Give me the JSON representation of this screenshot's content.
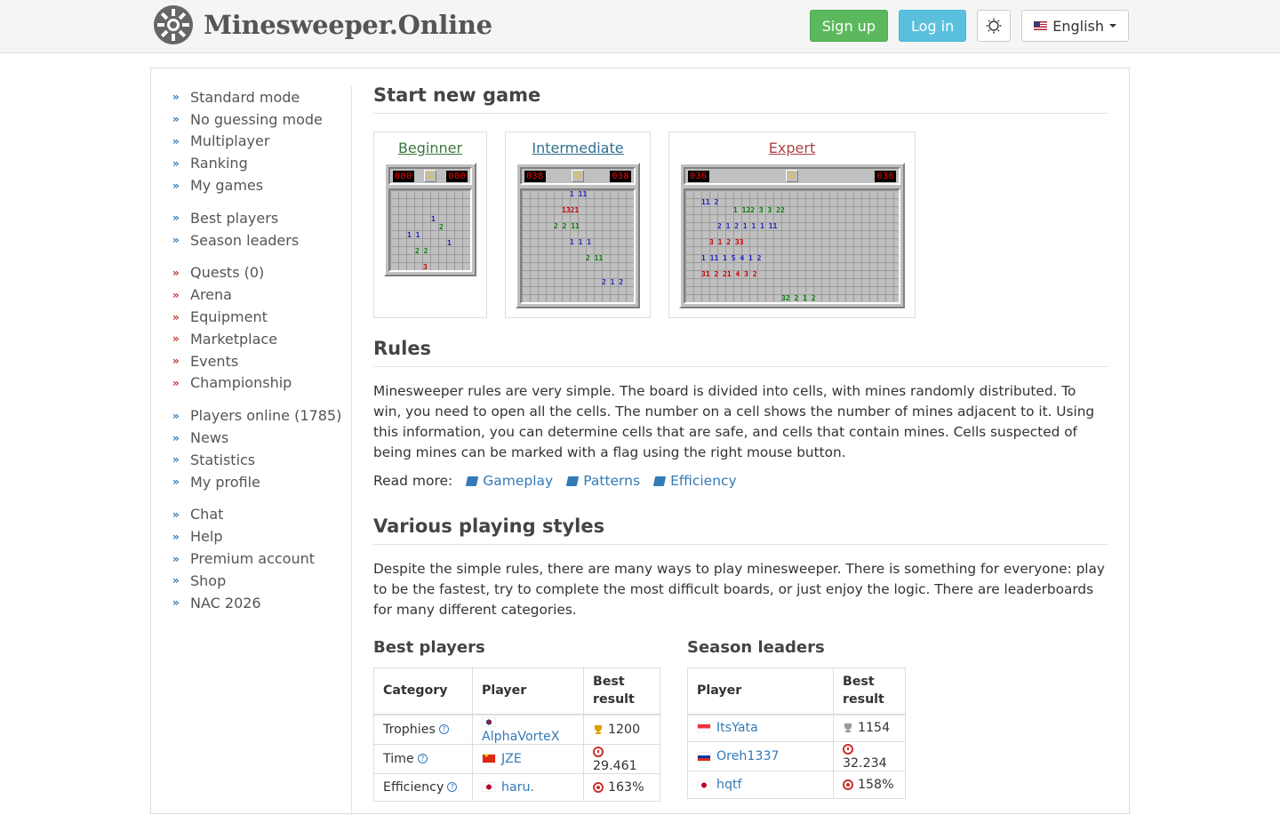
{
  "header": {
    "brand_title": "Minesweeper.Online",
    "signup_label": "Sign up",
    "login_label": "Log in",
    "language_label": "English"
  },
  "sidebar": {
    "groups": [
      [
        "Standard mode",
        "No guessing mode",
        "Multiplayer",
        "Ranking",
        "My games"
      ],
      [
        "Best players",
        "Season leaders"
      ],
      [
        "Quests (0)",
        "Arena",
        "Equipment",
        "Marketplace",
        "Events",
        "Championship"
      ],
      [
        "Players online (1785)",
        "News",
        "Statistics",
        "My profile"
      ],
      [
        "Chat",
        "Help",
        "Premium account",
        "Shop",
        "NAC 2026"
      ]
    ]
  },
  "start": {
    "heading": "Start new game",
    "beginner": {
      "label": "Beginner",
      "left_counter": "000",
      "right_counter": "000"
    },
    "intermediate": {
      "label": "Intermediate",
      "left_counter": "038",
      "right_counter": "038"
    },
    "expert": {
      "label": "Expert",
      "left_counter": "036",
      "right_counter": "036"
    }
  },
  "rules": {
    "heading": "Rules",
    "text": "Minesweeper rules are very simple. The board is divided into cells, with mines randomly distributed. To win, you need to open all the cells. The number on a cell shows the number of mines adjacent to it. Using this information, you can determine cells that are safe, and cells that contain mines. Cells suspected of being mines can be marked with a flag using the right mouse button.",
    "read_more_label": "Read more:",
    "links": [
      "Gameplay",
      "Patterns",
      "Efficiency"
    ]
  },
  "styles": {
    "heading": "Various playing styles",
    "text": "Despite the simple rules, there are many ways to play minesweeper. There is something for everyone: play to be the fastest, try to complete the most difficult boards, or just enjoy the logic. There are leaderboards for many different categories."
  },
  "best_players": {
    "heading": "Best players",
    "columns": [
      "Category",
      "Player",
      "Best result"
    ],
    "rows": [
      {
        "category": "Trophies",
        "player": "AlphaVorteX",
        "result": "1200"
      },
      {
        "category": "Time",
        "player": "JZE",
        "result": "29.461"
      },
      {
        "category": "Efficiency",
        "player": "haru.",
        "result": "163%"
      }
    ]
  },
  "season_leaders": {
    "heading": "Season leaders",
    "columns": [
      "Player",
      "Best result"
    ],
    "rows": [
      {
        "player": "ItsYata",
        "result": "1154"
      },
      {
        "player": "Oreh1337",
        "result": "32.234"
      },
      {
        "player": "hqtf",
        "result": "158%"
      }
    ]
  },
  "colors": {
    "signup": "#5cb85c",
    "login": "#5bc0de",
    "link": "#337ab7"
  }
}
